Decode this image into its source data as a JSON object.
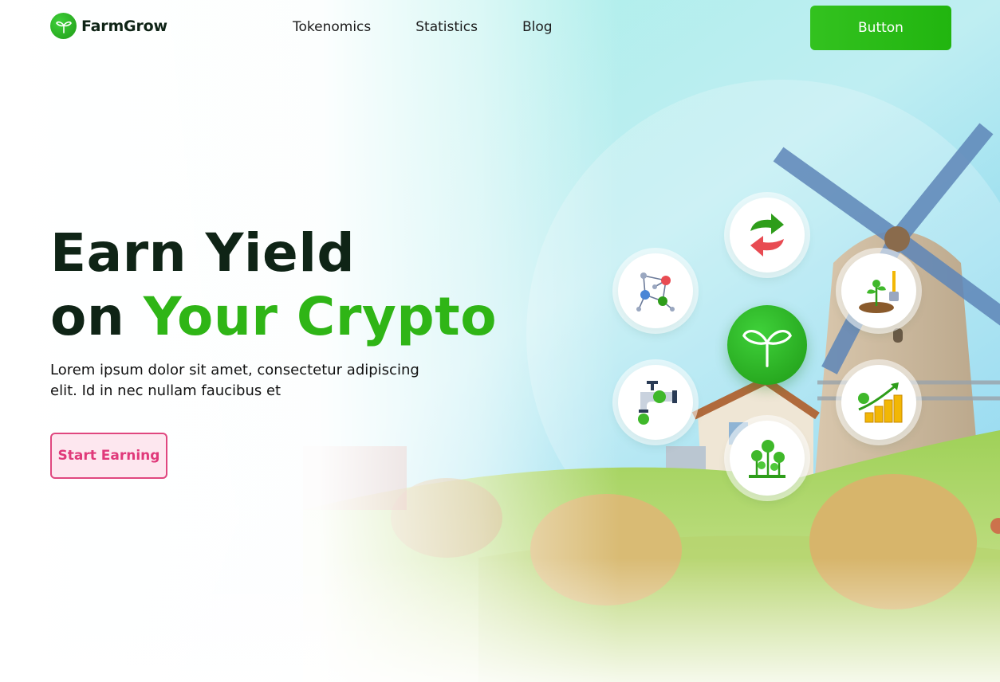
{
  "brand": {
    "name": "FarmGrow",
    "accent": "#2fb516",
    "dark": "#0f2416"
  },
  "nav": {
    "items": [
      "Tokenomics",
      "Statistics",
      "Blog"
    ]
  },
  "header": {
    "button_label": "Button"
  },
  "hero": {
    "title_line1": "Earn Yield",
    "title_line2_prefix": "on ",
    "title_line2_accent": "Your Crypto",
    "subtitle": "Lorem ipsum dolor sit amet, consectetur adipiscing elit. Id in nec nullam faucibus et",
    "cta_label": "Start Earning",
    "cta_color": "#e0397a"
  },
  "features": [
    {
      "icon": "swap-icon"
    },
    {
      "icon": "network-icon"
    },
    {
      "icon": "planting-icon"
    },
    {
      "icon": "faucet-icon"
    },
    {
      "icon": "growth-coins-icon"
    },
    {
      "icon": "farm-sprouts-icon"
    }
  ]
}
